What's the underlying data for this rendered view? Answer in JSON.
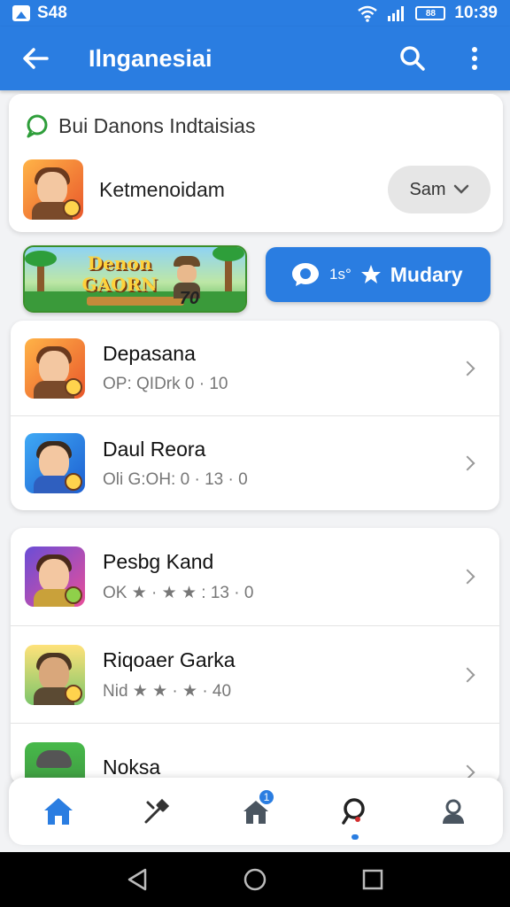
{
  "status_bar": {
    "left_text": "S48",
    "time": "10:39",
    "battery_text": "88"
  },
  "app_bar": {
    "title": "Ilnganesiai"
  },
  "top_card": {
    "header": "Bui Danons Indtaisias",
    "item_name": "Ketmenoidam",
    "pill_label": "Sam"
  },
  "banner": {
    "title_line1": "Denon",
    "title_line2": "GAORN",
    "number": "70"
  },
  "cta": {
    "small_text": "1s°",
    "label": "Mudary"
  },
  "list_one": [
    {
      "title": "Depasana",
      "sub": "OP: QIDrk 0 ·  10"
    },
    {
      "title": "Daul Reora",
      "sub": "Oli G:OH: 0 ·  13 · 0"
    }
  ],
  "list_two": [
    {
      "title": "Pesbg Kand",
      "sub": "OK ★ · ★ ★ :   13 · 0"
    },
    {
      "title": "Riqoaer Garka",
      "sub": "Nid ★ ★ · ★ ·  40"
    },
    {
      "title": "Noksa",
      "sub": ""
    }
  ],
  "nav": {
    "badge": "1"
  },
  "colors": {
    "accent": "#2a7de1",
    "background": "#f2f3f5"
  }
}
